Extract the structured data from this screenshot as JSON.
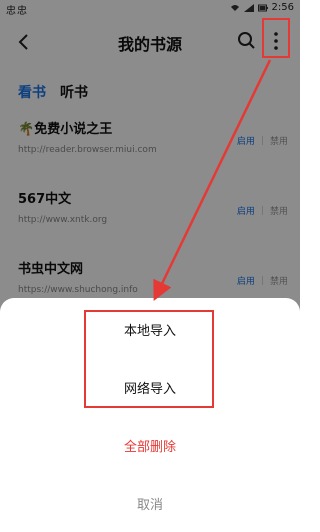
{
  "status_bar": {
    "left_icons": "忠忠",
    "time": "2:56",
    "icons": [
      "wifi-icon",
      "signal-icon",
      "battery-icon"
    ]
  },
  "header": {
    "title": "我的书源",
    "back_icon": "back-icon",
    "search_icon": "search-icon",
    "more_icon": "more-vertical-icon"
  },
  "tabs": [
    {
      "label": "看书"
    },
    {
      "label": "听书"
    }
  ],
  "sources": [
    {
      "name": "免费小说之王",
      "url": "http://reader.browser.miui.com",
      "enable": "启用",
      "disable": "禁用",
      "icon": "palm-tree-icon"
    },
    {
      "name": "567中文",
      "url": "http://www.xntk.org",
      "enable": "启用",
      "disable": "禁用"
    },
    {
      "name": "书虫中文网",
      "url": "https://www.shuchong.info",
      "enable": "启用",
      "disable": "禁用"
    }
  ],
  "sheet": {
    "local_import": "本地导入",
    "network_import": "网络导入",
    "delete_all": "全部删除",
    "cancel": "取消"
  },
  "colors": {
    "accent": "#1a73e8",
    "danger": "#e53935",
    "overlay": "rgba(0,0,0,0.45)"
  }
}
